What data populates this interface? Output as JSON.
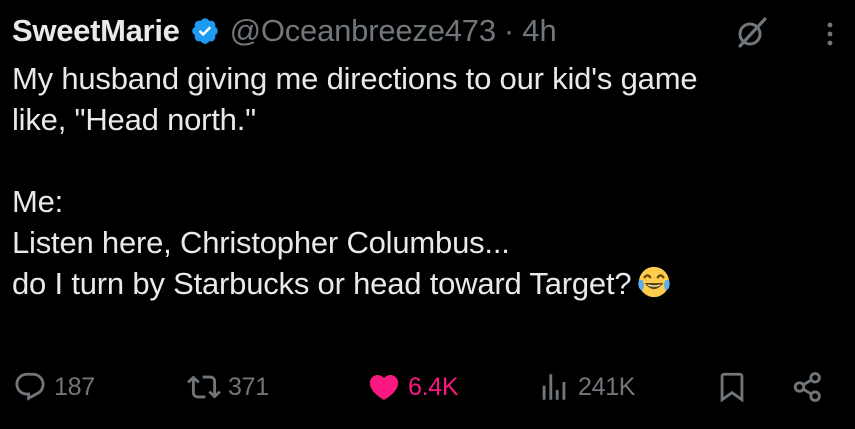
{
  "tweet": {
    "author": {
      "display_name": "SweetMarie",
      "handle": "@Oceanbreeze473",
      "separator": "·",
      "time": "4h",
      "verified": true
    },
    "text_lines": [
      "My husband giving me directions to our kid's game",
      "like, \"Head north.\"",
      "",
      "Me:",
      "Listen here, Christopher Columbus...",
      "do I turn by Starbucks or head toward Target?"
    ],
    "emoji": "face-with-tears-of-joy",
    "metrics": {
      "replies": "187",
      "reposts": "371",
      "likes": "6.4K",
      "views": "241K"
    }
  },
  "colors": {
    "background": "#000000",
    "text": "#e7e9ea",
    "muted": "#71767b",
    "verified": "#1d9bf0",
    "like": "#f91880"
  },
  "icons": {
    "verified": "verified-badge-icon",
    "grok": "grok-icon",
    "more": "more-options-icon",
    "reply": "reply-icon",
    "repost": "repost-icon",
    "like": "heart-icon",
    "views": "views-chart-icon",
    "bookmark": "bookmark-icon",
    "share": "share-icon"
  }
}
